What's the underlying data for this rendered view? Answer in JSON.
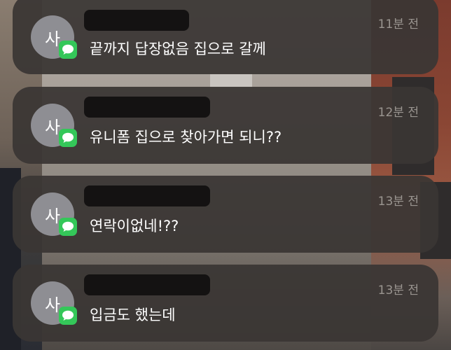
{
  "notifications": [
    {
      "avatar_initial": "사",
      "app_icon": "messages-icon",
      "time": "11분 전",
      "message": "끝까지 답장없음 집으로 갈께"
    },
    {
      "avatar_initial": "사",
      "app_icon": "messages-icon",
      "time": "12분 전",
      "message": "유니폼 집으로 찾아가면 되니??"
    },
    {
      "avatar_initial": "사",
      "app_icon": "messages-icon",
      "time": "13분 전",
      "message": "연락이없네!??"
    },
    {
      "avatar_initial": "사",
      "app_icon": "messages-icon",
      "time": "13분 전",
      "message": "입금도 했는데"
    }
  ],
  "colors": {
    "card_background": "#3a3634",
    "avatar_background": "#8e8e93",
    "messages_green": "#34c759",
    "time_text": "#9a9590",
    "message_text": "#ffffff"
  }
}
